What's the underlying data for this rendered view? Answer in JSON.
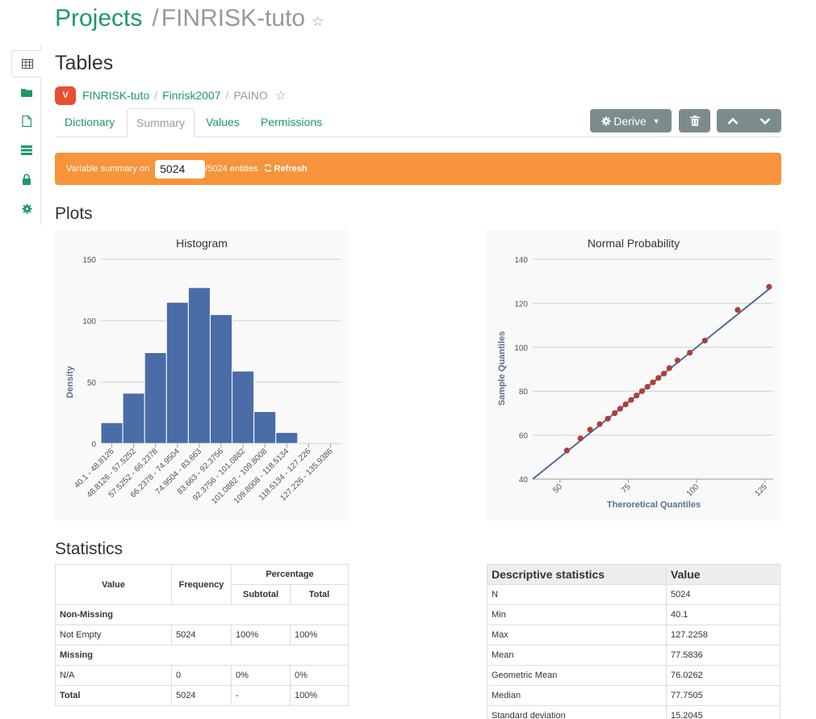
{
  "header": {
    "projects_label": "Projects",
    "separator": "/",
    "project_name": "FINRISK-tuto",
    "star": "☆"
  },
  "page_title": "Tables",
  "breadcrumb": {
    "badge": "V",
    "items": [
      "FINRISK-tuto",
      "Finrisk2007"
    ],
    "separator": "/",
    "current": "PAINO",
    "star": "☆"
  },
  "tabs": [
    "Dictionary",
    "Summary",
    "Values",
    "Permissions"
  ],
  "active_tab": "Summary",
  "toolbar": {
    "derive_label": "Derive",
    "delete_icon": "trash-icon",
    "up_icon": "chevron-up-icon",
    "down_icon": "chevron-down-icon"
  },
  "summary_bar": {
    "prefix": "Variable summary on",
    "value": "5024",
    "suffix": "/5024 entities",
    "refresh_label": "Refresh"
  },
  "plots_heading": "Plots",
  "statistics_heading": "Statistics",
  "colors": {
    "accent": "#1b9a63",
    "warning": "#f7943c",
    "bar": "#4a6da7",
    "point": "#b33c3c",
    "button": "#7c8c8c"
  },
  "chart_data": [
    {
      "type": "bar",
      "title": "Histogram",
      "ylabel": "Density",
      "categories": [
        "40.1 - 48.8126",
        "48.8126 - 57.5252",
        "57.5252 - 66.2378",
        "66.2378 - 74.9504",
        "74.9504 - 83.663",
        "83.663 - 92.3756",
        "92.3756 - 101.0882",
        "101.0882 - 109.8008",
        "109.8008 - 118.5134",
        "118.5134 - 127.226",
        "127.226 - 135.9386"
      ],
      "values": [
        17,
        41,
        74,
        115,
        127,
        105,
        59,
        26,
        9,
        0,
        0
      ],
      "ylim": [
        0,
        150
      ],
      "yticks": [
        0,
        50,
        100,
        150
      ],
      "grid": true
    },
    {
      "type": "scatter",
      "title": "Normal Probability",
      "xlabel": "Theroretical Quantiles",
      "ylabel": "Sample Quantiles",
      "x": [
        52.5,
        57.5,
        61.0,
        64.5,
        67.5,
        70.0,
        72.0,
        74.0,
        76.0,
        78.0,
        80.0,
        82.0,
        84.0,
        86.0,
        88.0,
        90.0,
        93.0,
        97.5,
        103.0,
        115.0,
        126.5
      ],
      "y": [
        53,
        58.5,
        62.5,
        65,
        67.5,
        70,
        72,
        74,
        76,
        78,
        80,
        82,
        84,
        86,
        88,
        90.5,
        94,
        97.5,
        103,
        117,
        127.5
      ],
      "reference_line": {
        "x": [
          40,
          127
        ],
        "y": [
          40,
          127
        ]
      },
      "xlim": [
        40,
        128
      ],
      "ylim": [
        40,
        140
      ],
      "xticks": [
        50,
        75,
        100,
        125
      ],
      "yticks": [
        40,
        60,
        80,
        100,
        120,
        140
      ],
      "grid": true
    }
  ],
  "freq_table": {
    "headers": {
      "value": "Value",
      "frequency": "Frequency",
      "percentage": "Percentage",
      "subtotal": "Subtotal",
      "total": "Total"
    },
    "groups": [
      {
        "label": "Non-Missing",
        "rows": [
          [
            "Not Empty",
            "5024",
            "100%",
            "100%"
          ]
        ]
      },
      {
        "label": "Missing",
        "rows": [
          [
            "N/A",
            "0",
            "0%",
            "0%"
          ]
        ]
      }
    ],
    "total_row": [
      "Total",
      "5024",
      "-",
      "100%"
    ]
  },
  "desc_table": {
    "headers": [
      "Descriptive statistics",
      "Value"
    ],
    "rows": [
      [
        "N",
        "5024"
      ],
      [
        "Min",
        "40.1"
      ],
      [
        "Max",
        "127.2258"
      ],
      [
        "Mean",
        "77.5836"
      ],
      [
        "Geometric Mean",
        "76.0262"
      ],
      [
        "Median",
        "77.7505"
      ],
      [
        "Standard deviation",
        "15.2045"
      ]
    ]
  }
}
